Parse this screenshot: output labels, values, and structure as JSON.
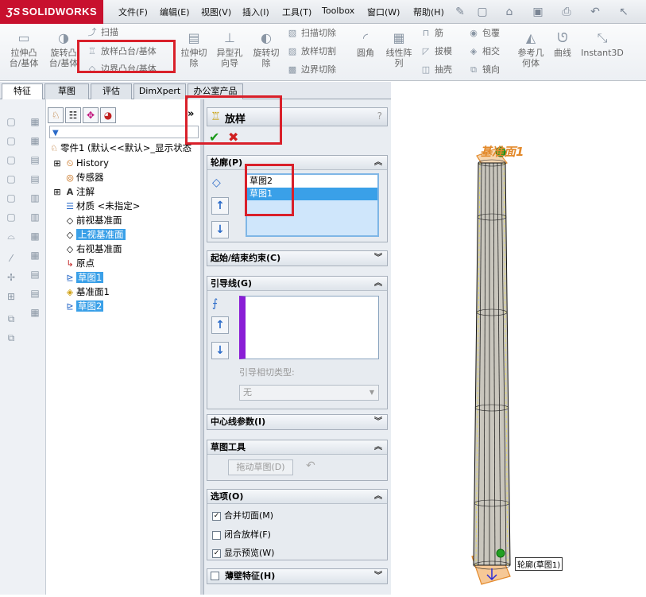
{
  "app": {
    "logo_text": "SOLIDWORKS"
  },
  "menu": [
    "文件(F)",
    "编辑(E)",
    "视图(V)",
    "插入(I)",
    "工具(T)",
    "Toolbox",
    "窗口(W)",
    "帮助(H)"
  ],
  "ribbon": {
    "extrude_boss": "拉伸凸\n台/基体",
    "revolve_boss": "旋转凸\n台/基体",
    "sweep": "扫描",
    "loft_boss": "放样凸台/基体",
    "boundary_boss": "边界凸台/基体",
    "extrude_cut": "拉伸切\n除",
    "hole_wizard": "异型孔\n向导",
    "revolve_cut": "旋转切\n除",
    "swept_cut": "扫描切除",
    "lofted_cut": "放样切割",
    "boundary_cut": "边界切除",
    "fillet": "圆角",
    "linear_pattern": "线性阵\n列",
    "rib": "筋",
    "draft": "拔模",
    "shell": "抽壳",
    "wrap": "包覆",
    "intersect": "相交",
    "mirror": "镜向",
    "ref_geometry": "参考几\n何体",
    "curves": "曲线",
    "instant3d": "Instant3D"
  },
  "tabs": [
    "特征",
    "草图",
    "评估",
    "DimXpert",
    "办公室产品"
  ],
  "tree": {
    "root": "零件1 (默认<<默认>_显示状态",
    "items": [
      "History",
      "传感器",
      "注解",
      "材质 <未指定>",
      "前视基准面",
      "上视基准面",
      "右视基准面",
      "原点",
      "草图1",
      "基准面1",
      "草图2"
    ]
  },
  "pm": {
    "title": "放样",
    "help": "?",
    "profiles": {
      "header": "轮廓(P)",
      "items": [
        "草图2",
        "草图1"
      ]
    },
    "constraints": {
      "header": "起始/结束约束(C)"
    },
    "guides": {
      "header": "引导线(G)",
      "tangency_label": "引导相切类型:",
      "tangency_value": "无"
    },
    "centerline": {
      "header": "中心线参数(I)"
    },
    "sketch_tools": {
      "header": "草图工具",
      "drag_sketch": "拖动草图(D)"
    },
    "options": {
      "header": "选项(O)",
      "merge_tangent": "合并切面(M)",
      "close_loft": "闭合放样(F)",
      "show_preview": "显示预览(W)"
    },
    "thin": {
      "header": "薄壁特征(H)"
    }
  },
  "viewport": {
    "top_label": "基准面1",
    "bottom_label": "轮廓(草图1)"
  },
  "colors": {
    "accent": "#3aa0e8",
    "highlight_red": "#d9202a",
    "guide_purple": "#8a1ed6",
    "profile_blue": "#8ec8f2"
  }
}
